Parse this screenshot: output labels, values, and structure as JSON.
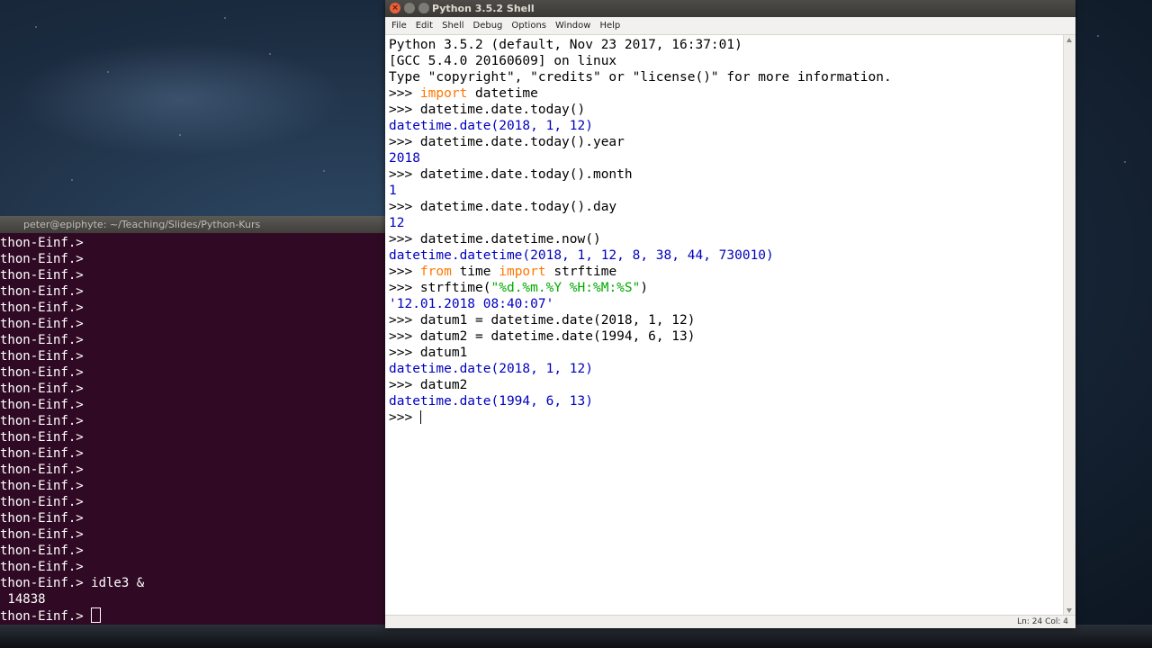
{
  "terminal": {
    "title": "peter@epiphyte: ~/Teaching/Slides/Python-Kurs",
    "lines": [
      "thon-Einf.>",
      "thon-Einf.>",
      "thon-Einf.>",
      "thon-Einf.>",
      "thon-Einf.>",
      "thon-Einf.>",
      "thon-Einf.>",
      "thon-Einf.>",
      "thon-Einf.>",
      "thon-Einf.>",
      "thon-Einf.>",
      "thon-Einf.>",
      "thon-Einf.>",
      "thon-Einf.>",
      "thon-Einf.>",
      "thon-Einf.>",
      "thon-Einf.>",
      "thon-Einf.>",
      "thon-Einf.>",
      "thon-Einf.>",
      "thon-Einf.>",
      "thon-Einf.> idle3 &",
      " 14838",
      "thon-Einf.> "
    ]
  },
  "idle": {
    "title": "Python 3.5.2 Shell",
    "window_buttons": [
      "×",
      "",
      ""
    ],
    "menu": [
      "File",
      "Edit",
      "Shell",
      "Debug",
      "Options",
      "Window",
      "Help"
    ],
    "header_lines": [
      "Python 3.5.2 (default, Nov 23 2017, 16:37:01)",
      "[GCC 5.4.0 20160609] on linux",
      "Type \"copyright\", \"credits\" or \"license()\" for more information."
    ],
    "prompt": ">>> ",
    "session": [
      {
        "kind": "in",
        "segments": [
          {
            "t": "import",
            "c": "kw"
          },
          {
            "t": " datetime",
            "c": ""
          }
        ]
      },
      {
        "kind": "in",
        "segments": [
          {
            "t": "datetime.date.today()",
            "c": ""
          }
        ]
      },
      {
        "kind": "out",
        "text": "datetime.date(2018, 1, 12)"
      },
      {
        "kind": "in",
        "segments": [
          {
            "t": "datetime.date.today().year",
            "c": ""
          }
        ]
      },
      {
        "kind": "out",
        "text": "2018"
      },
      {
        "kind": "in",
        "segments": [
          {
            "t": "datetime.date.today().month",
            "c": ""
          }
        ]
      },
      {
        "kind": "out",
        "text": "1"
      },
      {
        "kind": "in",
        "segments": [
          {
            "t": "datetime.date.today().day",
            "c": ""
          }
        ]
      },
      {
        "kind": "out",
        "text": "12"
      },
      {
        "kind": "in",
        "segments": [
          {
            "t": "datetime.datetime.now()",
            "c": ""
          }
        ]
      },
      {
        "kind": "out",
        "text": "datetime.datetime(2018, 1, 12, 8, 38, 44, 730010)"
      },
      {
        "kind": "in",
        "segments": [
          {
            "t": "from",
            "c": "kw"
          },
          {
            "t": " time ",
            "c": ""
          },
          {
            "t": "import",
            "c": "kw"
          },
          {
            "t": " strftime",
            "c": ""
          }
        ]
      },
      {
        "kind": "in",
        "segments": [
          {
            "t": "strftime(",
            "c": ""
          },
          {
            "t": "\"%d.%m.%Y %H:%M:%S\"",
            "c": "str"
          },
          {
            "t": ")",
            "c": ""
          }
        ]
      },
      {
        "kind": "out",
        "text": "'12.01.2018 08:40:07'"
      },
      {
        "kind": "in",
        "segments": [
          {
            "t": "datum1 = datetime.date(2018, 1, 12)",
            "c": ""
          }
        ]
      },
      {
        "kind": "in",
        "segments": [
          {
            "t": "datum2 = datetime.date(1994, 6, 13)",
            "c": ""
          }
        ]
      },
      {
        "kind": "in",
        "segments": [
          {
            "t": "datum1",
            "c": ""
          }
        ]
      },
      {
        "kind": "out",
        "text": "datetime.date(2018, 1, 12)"
      },
      {
        "kind": "in",
        "segments": [
          {
            "t": "datum2",
            "c": ""
          }
        ]
      },
      {
        "kind": "out",
        "text": "datetime.date(1994, 6, 13)"
      }
    ],
    "status": "Ln: 24  Col: 4"
  }
}
